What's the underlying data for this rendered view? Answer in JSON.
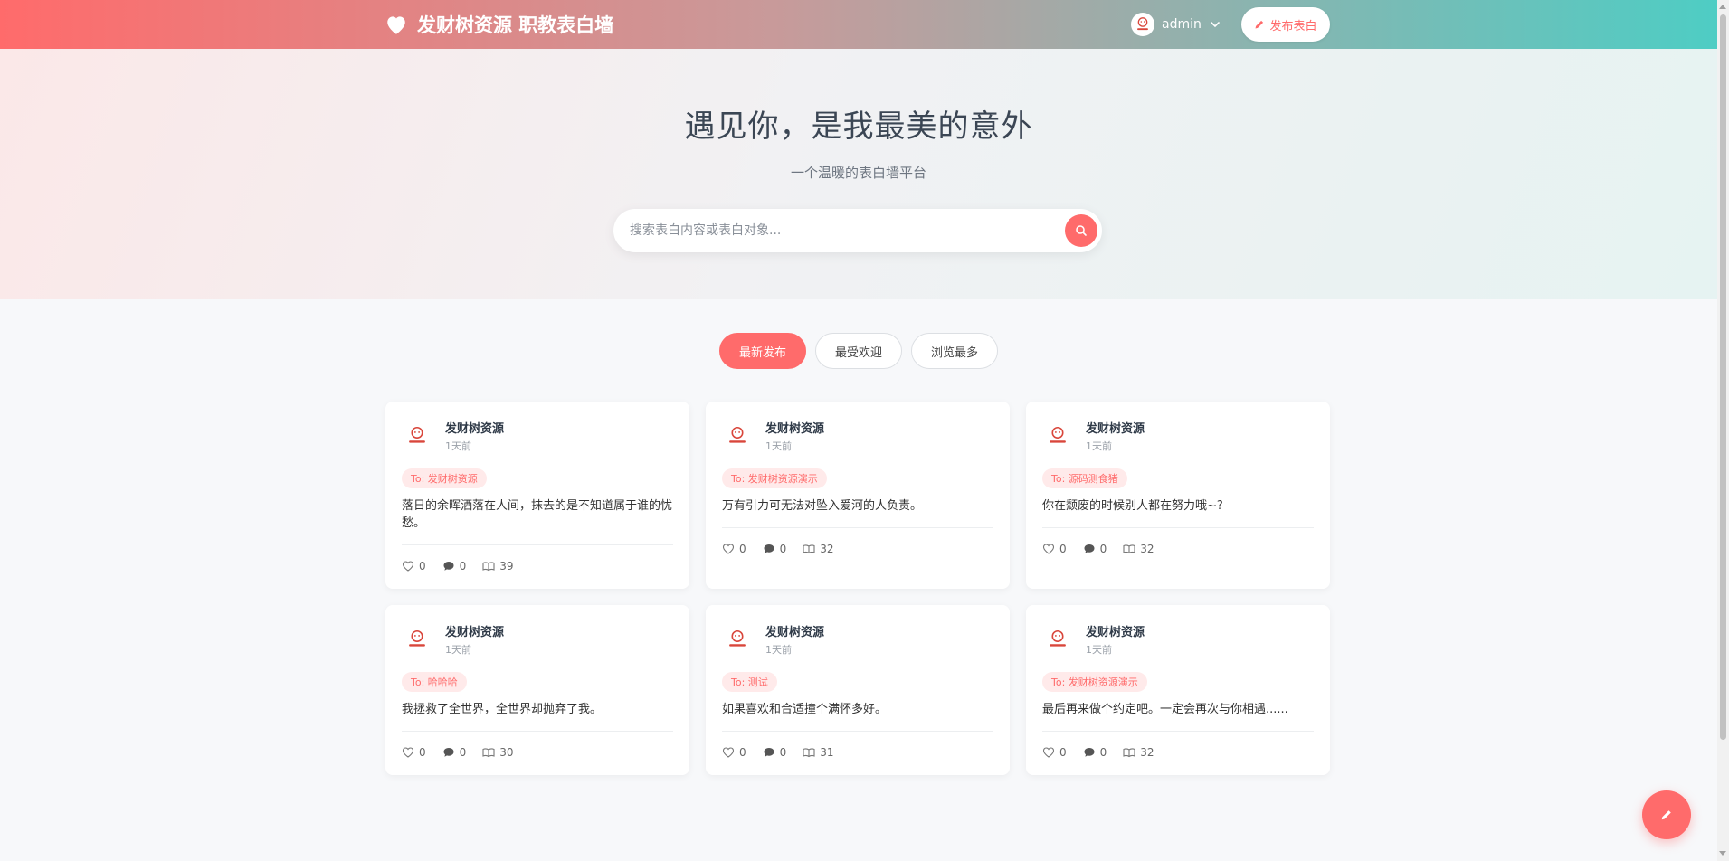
{
  "navbar": {
    "brand_title": "发财树资源 职教表白墙",
    "username": "admin",
    "publish_label": "发布表白"
  },
  "hero": {
    "title": "遇见你，是我最美的意外",
    "subtitle": "一个温暖的表白墙平台",
    "search_placeholder": "搜索表白内容或表白对象..."
  },
  "tabs": [
    {
      "label": "最新发布",
      "active": true
    },
    {
      "label": "最受欢迎",
      "active": false
    },
    {
      "label": "浏览最多",
      "active": false
    }
  ],
  "cards": [
    {
      "author": "发财树资源",
      "time": "1天前",
      "to": "To: 发财树资源",
      "content": "落日的余晖洒落在人间，抹去的是不知道属于谁的忧愁。",
      "likes": "0",
      "comments": "0",
      "views": "39"
    },
    {
      "author": "发财树资源",
      "time": "1天前",
      "to": "To: 发财树资源演示",
      "content": "万有引力可无法对坠入爱河的人负责。",
      "likes": "0",
      "comments": "0",
      "views": "32"
    },
    {
      "author": "发财树资源",
      "time": "1天前",
      "to": "To: 源码测食猪",
      "content": "你在颓废的时候别人都在努力哦~?",
      "likes": "0",
      "comments": "0",
      "views": "32"
    },
    {
      "author": "发财树资源",
      "time": "1天前",
      "to": "To: 哈哈哈",
      "content": "我拯救了全世界，全世界却抛弃了我。",
      "likes": "0",
      "comments": "0",
      "views": "30"
    },
    {
      "author": "发财树资源",
      "time": "1天前",
      "to": "To: 测试",
      "content": "如果喜欢和合适撞个满怀多好。",
      "likes": "0",
      "comments": "0",
      "views": "31"
    },
    {
      "author": "发财树资源",
      "time": "1天前",
      "to": "To: 发财树资源演示",
      "content": "最后再来做个约定吧。一定会再次与你相遇......",
      "likes": "0",
      "comments": "0",
      "views": "32"
    }
  ],
  "colors": {
    "accent": "#ff6b6b",
    "teal": "#4ecdc4",
    "page_bg": "#f7f8fa"
  },
  "icons": {
    "brand": "heart-icon",
    "publish": "pencil-icon",
    "search": "search-icon",
    "like": "heart-outline-icon",
    "comment": "comment-icon",
    "views": "book-open-icon",
    "fab": "pencil-icon"
  }
}
